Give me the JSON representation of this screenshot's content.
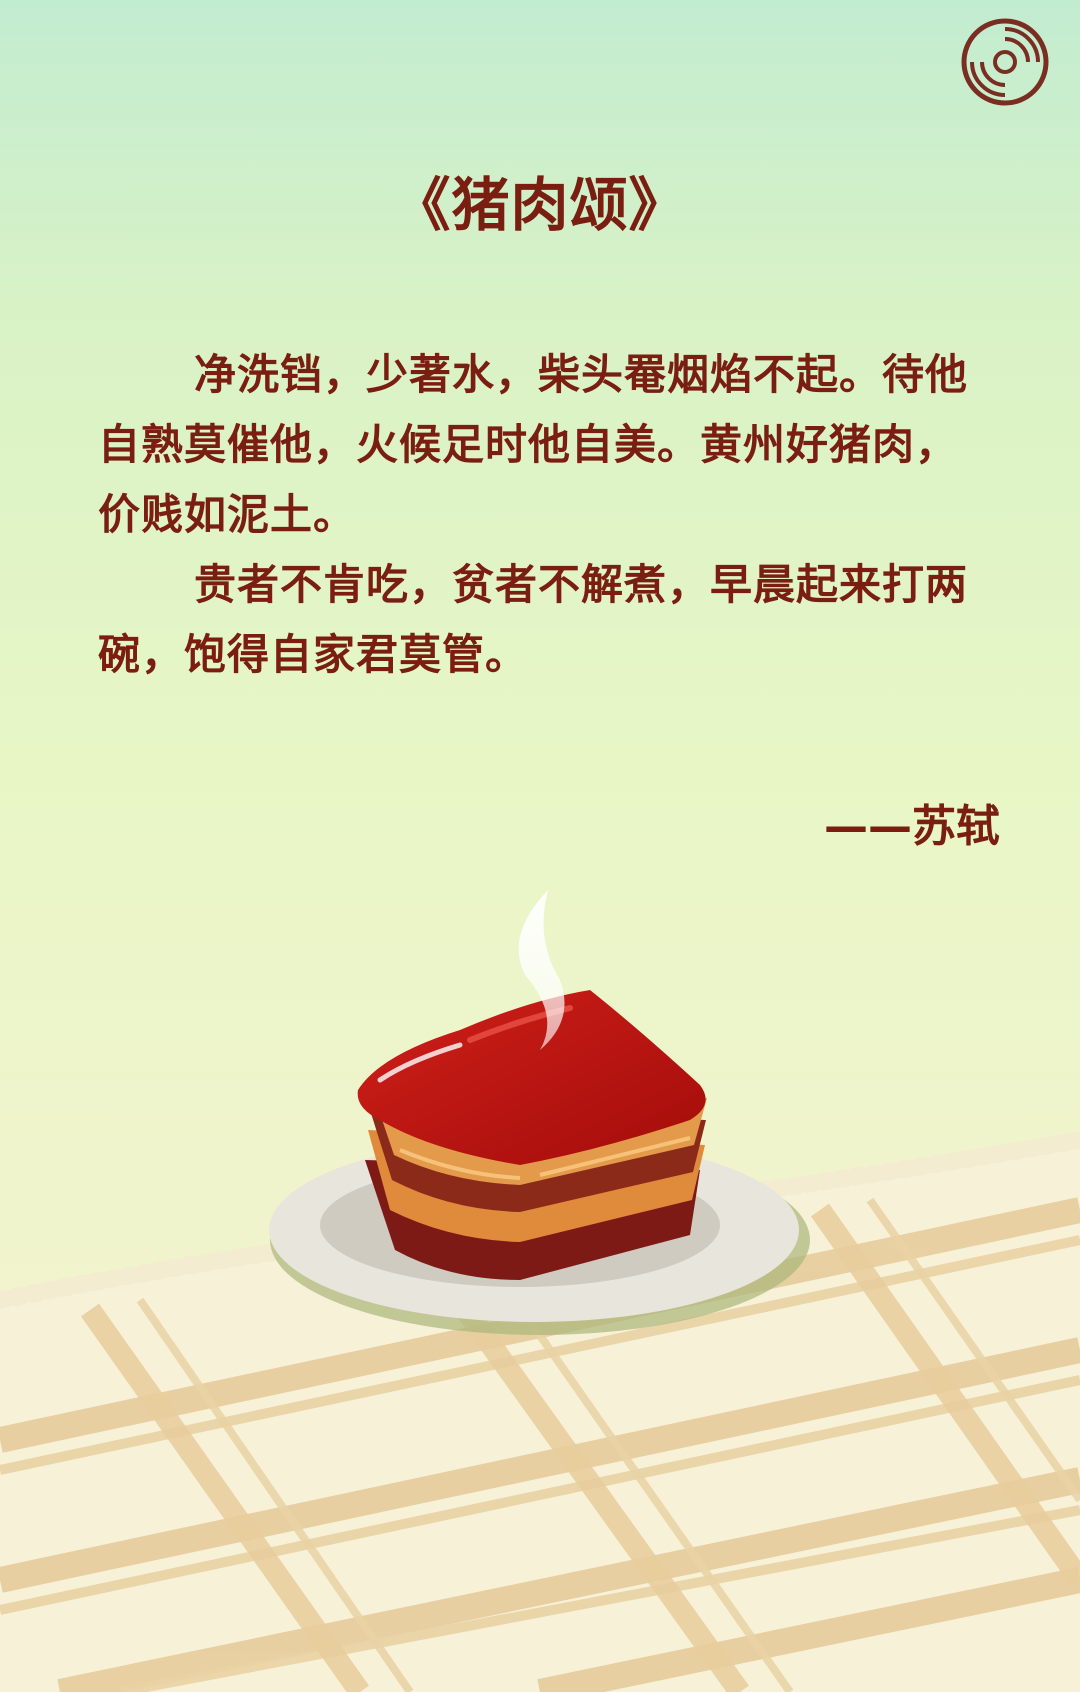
{
  "title": "《猪肉颂》",
  "poem": {
    "paragraph_1": "净洗铛，少著水，柴头罨烟焰不起。待他自熟莫催他，火候足时他自美。黄州好猪肉，价贱如泥土。",
    "paragraph_2": "贵者不肯吃，贫者不解煮，早晨起来打两碗，饱得自家君莫管。"
  },
  "author": "——苏轼",
  "icons": {
    "music": "music-disc-icon"
  },
  "colors": {
    "text": "#7a1e12",
    "pork_glaze": "#b8140e",
    "plate": "#e6e3d9",
    "tablecloth_stripe": "#e8cfa0"
  }
}
